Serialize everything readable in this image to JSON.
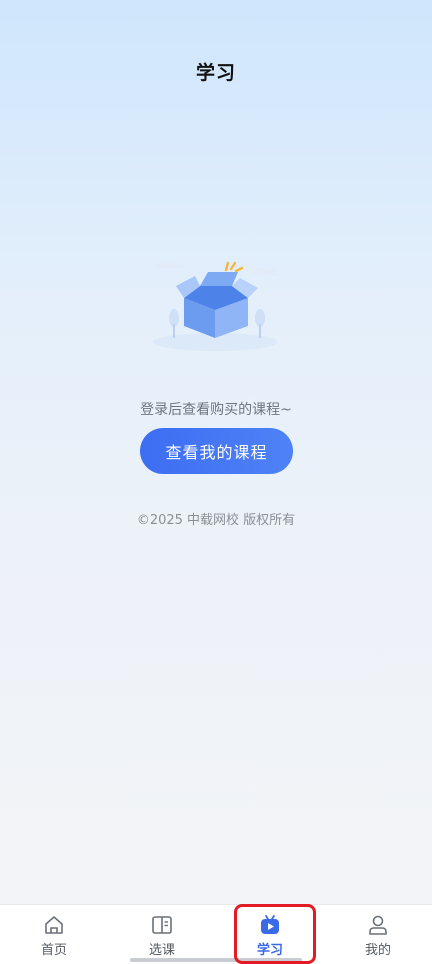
{
  "header": {
    "title": "学习"
  },
  "empty_state": {
    "illustration": "open-box-icon",
    "hint": "登录后查看购买的课程~",
    "button_label": "查看我的课程"
  },
  "footer": {
    "copyright": "©2025 中载网校 版权所有"
  },
  "tabbar": {
    "tabs": [
      {
        "label": "首页",
        "icon": "home-icon",
        "active": false
      },
      {
        "label": "选课",
        "icon": "book-icon",
        "active": false
      },
      {
        "label": "学习",
        "icon": "play-icon",
        "active": true
      },
      {
        "label": "我的",
        "icon": "user-icon",
        "active": false
      }
    ]
  },
  "colors": {
    "accent": "#3a6ae8",
    "highlight": "#e21b24"
  }
}
